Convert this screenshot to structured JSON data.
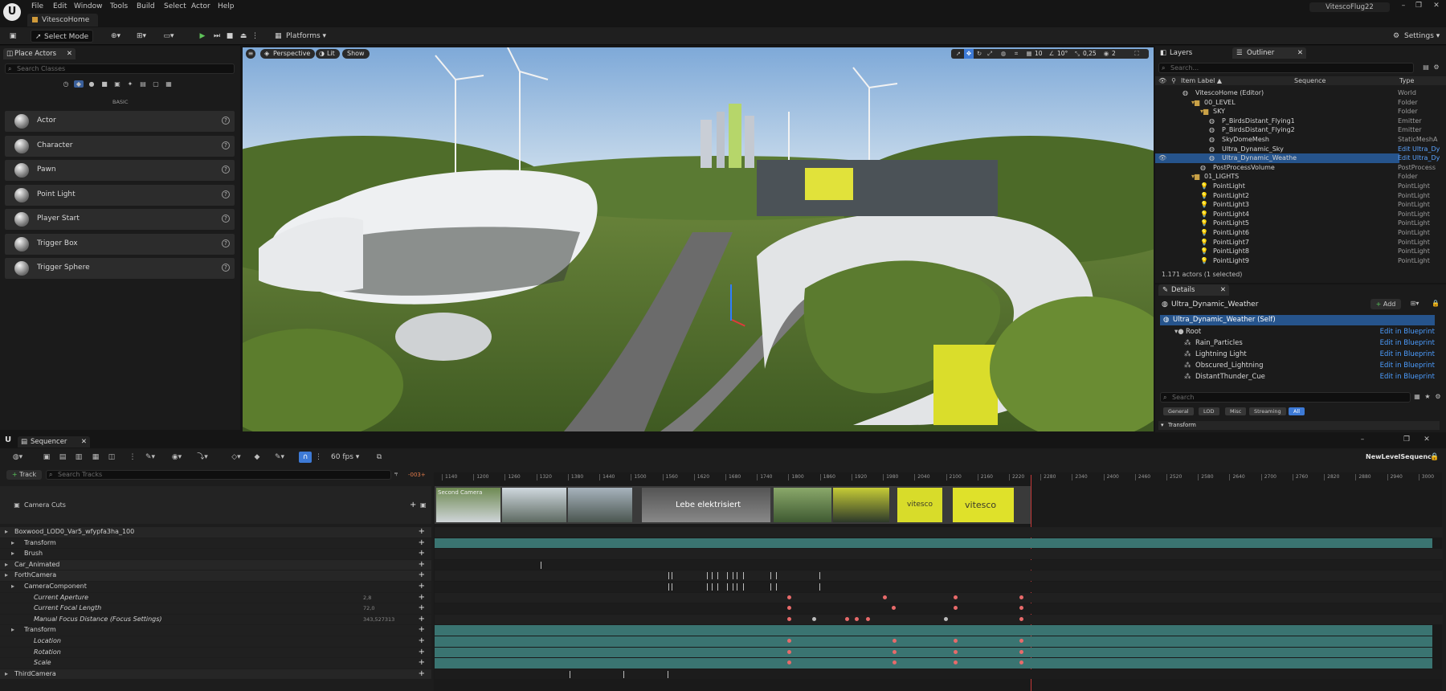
{
  "app": {
    "project_name": "VitescoFlug22",
    "level_tab": "VitescoHome"
  },
  "menu": [
    "File",
    "Edit",
    "Window",
    "Tools",
    "Build",
    "Select",
    "Actor",
    "Help"
  ],
  "toolbar": {
    "select_mode": "Select Mode",
    "platforms": "Platforms",
    "settings": "Settings"
  },
  "place_actors": {
    "tab": "Place Actors",
    "search_placeholder": "Search Classes",
    "section": "BASIC",
    "items": [
      "Actor",
      "Character",
      "Pawn",
      "Point Light",
      "Player Start",
      "Trigger Box",
      "Trigger Sphere"
    ]
  },
  "viewport": {
    "perspective": "Perspective",
    "lit": "Lit",
    "show": "Show",
    "grid_snap": "10",
    "rot_snap": "10°",
    "scale_snap": "0,25",
    "cam_speed": "2"
  },
  "outliner": {
    "tabs": [
      "Layers",
      "Outliner"
    ],
    "search_placeholder": "Search...",
    "col_item": "Item Label ▲",
    "col_sequence": "Sequence",
    "col_type": "Type",
    "rows": [
      {
        "name": "VitescoHome (Editor)",
        "type": "World",
        "indent": 0
      },
      {
        "name": "00_LEVEL",
        "type": "Folder",
        "indent": 1
      },
      {
        "name": "SKY",
        "type": "Folder",
        "indent": 2
      },
      {
        "name": "P_BirdsDistant_Flying1",
        "type": "Emitter",
        "indent": 3
      },
      {
        "name": "P_BirdsDistant_Flying2",
        "type": "Emitter",
        "indent": 3
      },
      {
        "name": "SkyDomeMesh",
        "type": "StaticMeshA",
        "indent": 3
      },
      {
        "name": "Ultra_Dynamic_Sky",
        "type": "Edit Ultra_Dy",
        "indent": 3,
        "link": true
      },
      {
        "name": "Ultra_Dynamic_Weathe",
        "type": "Edit Ultra_Dy",
        "indent": 3,
        "link": true,
        "selected": true
      },
      {
        "name": "PostProcessVolume",
        "type": "PostProcess",
        "indent": 2
      },
      {
        "name": "01_LIGHTS",
        "type": "Folder",
        "indent": 1
      },
      {
        "name": "PointLight",
        "type": "PointLight",
        "indent": 2
      },
      {
        "name": "PointLight2",
        "type": "PointLight",
        "indent": 2
      },
      {
        "name": "PointLight3",
        "type": "PointLight",
        "indent": 2
      },
      {
        "name": "PointLight4",
        "type": "PointLight",
        "indent": 2
      },
      {
        "name": "PointLight5",
        "type": "PointLight",
        "indent": 2
      },
      {
        "name": "PointLight6",
        "type": "PointLight",
        "indent": 2
      },
      {
        "name": "PointLight7",
        "type": "PointLight",
        "indent": 2
      },
      {
        "name": "PointLight8",
        "type": "PointLight",
        "indent": 2
      },
      {
        "name": "PointLight9",
        "type": "PointLight",
        "indent": 2
      }
    ],
    "status": "1.171 actors (1 selected)"
  },
  "details": {
    "tab": "Details",
    "actor_name": "Ultra_Dynamic_Weather",
    "add_label": "Add",
    "root_self": "Ultra_Dynamic_Weather (Self)",
    "tree": [
      {
        "name": "Root",
        "indent": 1,
        "action": "Edit in Blueprint"
      },
      {
        "name": "Rain_Particles",
        "indent": 2,
        "action": "Edit in Blueprint"
      },
      {
        "name": "Lightning Light",
        "indent": 2,
        "action": "Edit in Blueprint"
      },
      {
        "name": "Obscured_Lightning",
        "indent": 2,
        "action": "Edit in Blueprint"
      },
      {
        "name": "DistantThunder_Cue",
        "indent": 2,
        "action": "Edit in Blueprint"
      }
    ],
    "search_placeholder": "Search",
    "filters": [
      "General",
      "LOD",
      "Misc",
      "Streaming",
      "All"
    ],
    "section": "Transform"
  },
  "sequencer": {
    "tab": "Sequencer",
    "fps": "60 fps",
    "sequence_name": "NewLevelSequence",
    "track_btn": "Track",
    "search_placeholder": "Search Tracks",
    "current_frame": "-003+",
    "ticks": [
      "1140",
      "1200",
      "1260",
      "1320",
      "1380",
      "1440",
      "1500",
      "1560",
      "1620",
      "1680",
      "1740",
      "1800",
      "1860",
      "1920",
      "1980",
      "2040",
      "2100",
      "2160",
      "2220",
      "2280",
      "2340",
      "2400",
      "2460",
      "2520",
      "2580",
      "2640",
      "2700",
      "2760",
      "2820",
      "2880",
      "2940",
      "3000"
    ],
    "camera_cuts": "Camera Cuts",
    "thumb_text_1": "Second Camera",
    "thumb_text_2": "Lebe elektrisiert",
    "brand": "vitesco",
    "tracks": [
      {
        "label": "Boxwood_LOD0_Var5_wfypfa3ha_100",
        "indent": 0
      },
      {
        "label": "Transform",
        "indent": 1
      },
      {
        "label": "Brush",
        "indent": 1
      },
      {
        "label": "Car_Animated",
        "indent": 0
      },
      {
        "label": "ForthCamera",
        "indent": 0
      },
      {
        "label": "CameraComponent",
        "indent": 1
      },
      {
        "label": "Current Aperture",
        "indent": 2,
        "value": "2,8"
      },
      {
        "label": "Current Focal Length",
        "indent": 2,
        "value": "72,0"
      },
      {
        "label": "Manual Focus Distance (Focus Settings)",
        "indent": 2,
        "value": "343,527313"
      },
      {
        "label": "Transform",
        "indent": 1
      },
      {
        "label": "Location",
        "indent": 2
      },
      {
        "label": "Rotation",
        "indent": 2
      },
      {
        "label": "Scale",
        "indent": 2
      },
      {
        "label": "ThirdCamera",
        "indent": 0
      }
    ]
  },
  "colors": {
    "accent": "#3d7ad6",
    "selection": "#26548c",
    "key": "#e86a6a",
    "track_fill": "#3a7471"
  }
}
